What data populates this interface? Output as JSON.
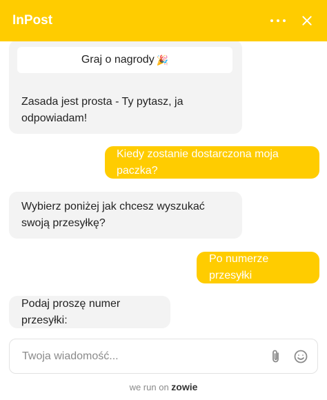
{
  "header": {
    "title": "InPost",
    "menu_icon": "more-dots-icon",
    "close_icon": "close-icon"
  },
  "chat": {
    "card_button_label": "Graj o nagrody",
    "card_button_emoji": "🎉",
    "messages": [
      {
        "from": "bot",
        "text": "Zasada jest prosta - Ty pytasz, ja odpowiadam!"
      },
      {
        "from": "user",
        "text": "Kiedy zostanie dostarczona moja paczka?"
      },
      {
        "from": "bot",
        "text": "Wybierz poniżej jak chcesz wyszukać swoją przesyłkę?"
      },
      {
        "from": "user",
        "text": "Po numerze przesyłki"
      },
      {
        "from": "bot",
        "text": "Podaj proszę numer przesyłki:"
      }
    ]
  },
  "composer": {
    "placeholder": "Twoja wiadomość...",
    "attach_icon": "paperclip-icon",
    "emoji_icon": "smiley-icon"
  },
  "footer": {
    "prefix": "we run on",
    "brand": "zowie"
  },
  "colors": {
    "accent": "#ffcc00",
    "bot_bubble": "#f3f3f3"
  }
}
